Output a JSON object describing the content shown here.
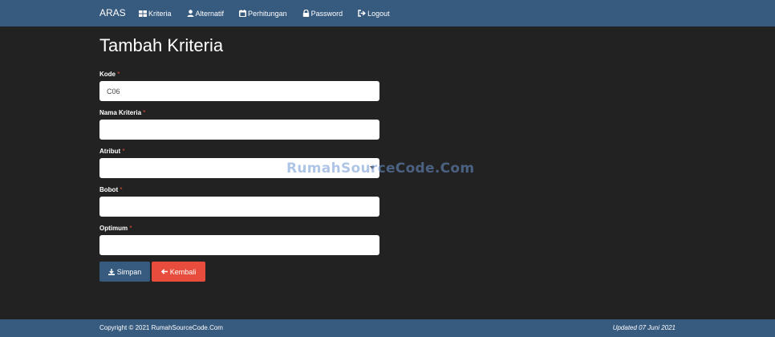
{
  "navbar": {
    "brand": "ARAS",
    "items": [
      {
        "label": "Kriteria",
        "icon": "grid-icon"
      },
      {
        "label": "Alternatif",
        "icon": "user-icon"
      },
      {
        "label": "Perhitungan",
        "icon": "calendar-icon"
      },
      {
        "label": "Password",
        "icon": "lock-icon"
      },
      {
        "label": "Logout",
        "icon": "logout-icon"
      }
    ]
  },
  "page": {
    "title": "Tambah Kriteria"
  },
  "form": {
    "required_mark": "*",
    "kode": {
      "label": "Kode",
      "value": "C06"
    },
    "nama": {
      "label": "Nama Kriteria",
      "value": ""
    },
    "atribut": {
      "label": "Atribut",
      "value": ""
    },
    "bobot": {
      "label": "Bobot",
      "value": ""
    },
    "optimum": {
      "label": "Optimum",
      "value": ""
    }
  },
  "buttons": {
    "save": "Simpan",
    "back": "Kembali"
  },
  "watermark": "RumahSourceCode.Com",
  "footer": {
    "copyright": "Copyright © 2021 RumahSourceCode.Com",
    "updated": "Updated 07 Juni 2021"
  },
  "colors": {
    "navbar": "#375a7f",
    "background": "#222222",
    "primary": "#375a7f",
    "danger": "#e74c3c"
  }
}
